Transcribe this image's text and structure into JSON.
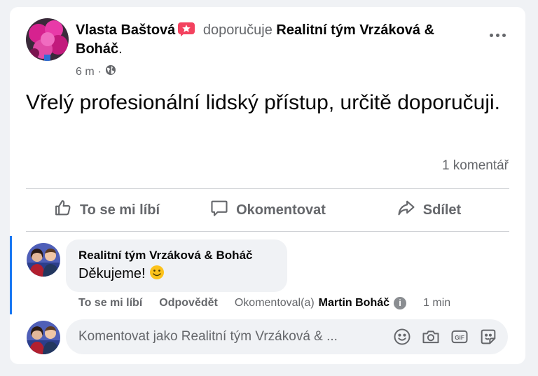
{
  "post": {
    "author": "Vlasta Baštová",
    "verb": "doporučuje",
    "target": "Realitní tým Vrzáková & Boháč",
    "target_suffix": ".",
    "time": "6 m",
    "separator": "·",
    "text": "Vřelý profesionální lidský přístup, určitě doporučuji.",
    "comment_count": "1 komentář",
    "icons": {
      "recommend": "recommend-star-icon",
      "more": "more-dots-icon",
      "audience": "globe-icon"
    }
  },
  "actions": {
    "like": "To se mi líbí",
    "comment": "Okomentovat",
    "share": "Sdílet",
    "icons": [
      "thumbs-up-icon",
      "comment-bubble-icon",
      "share-arrow-icon"
    ]
  },
  "comment": {
    "author": "Realitní tým Vrzáková & Boháč",
    "text": "Děkujeme!",
    "emoji": "smiley-emoji",
    "like": "To se mi líbí",
    "reply": "Odpovědět",
    "commented_by_prefix": "Okomentoval(a)",
    "commented_by_name": "Martin Boháč",
    "time": "1 min"
  },
  "composer": {
    "placeholder": "Komentovat jako Realitní tým Vrzáková & ...",
    "icons": [
      "emoji-icon",
      "camera-icon",
      "gif-icon",
      "sticker-icon"
    ]
  },
  "colors": {
    "accent": "#1877f2",
    "secondary_text": "#65676b",
    "recommend_badge": "#f3425f",
    "surface": "#f0f2f5"
  }
}
